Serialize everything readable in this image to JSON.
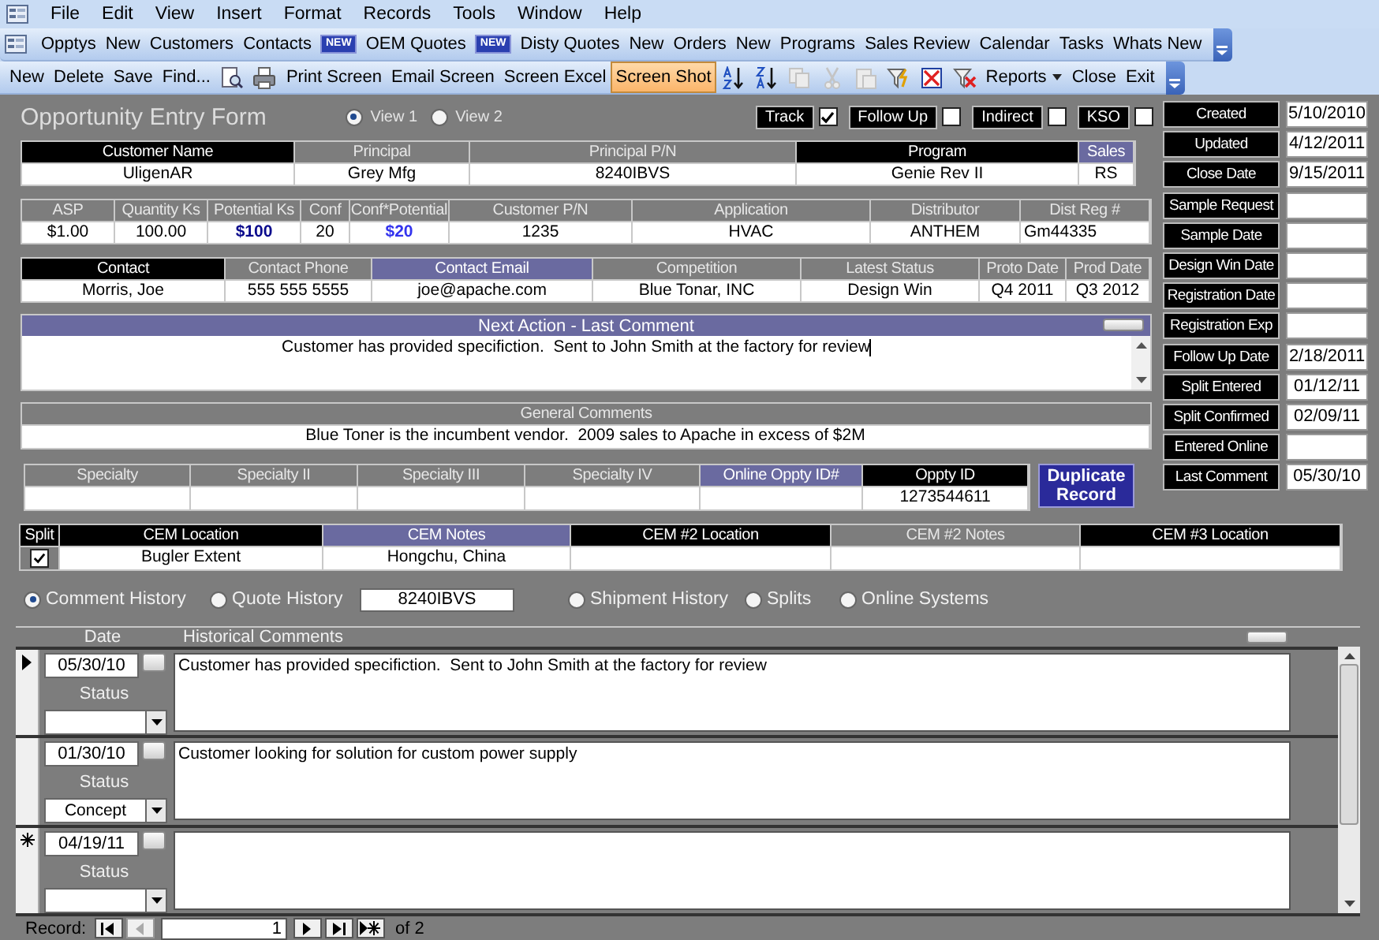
{
  "menu_bar": {
    "items": [
      "File",
      "Edit",
      "View",
      "Insert",
      "Format",
      "Records",
      "Tools",
      "Window",
      "Help"
    ]
  },
  "main_toolbar": {
    "items": [
      {
        "kind": "button",
        "label": "Opptys"
      },
      {
        "kind": "button",
        "label": "New"
      },
      {
        "kind": "button",
        "label": "Customers"
      },
      {
        "kind": "button",
        "label": "Contacts"
      },
      {
        "kind": "badge",
        "label": "NEW"
      },
      {
        "kind": "button",
        "label": "OEM Quotes"
      },
      {
        "kind": "badge",
        "label": "NEW"
      },
      {
        "kind": "button",
        "label": "Disty Quotes"
      },
      {
        "kind": "button",
        "label": "New"
      },
      {
        "kind": "button",
        "label": "Orders"
      },
      {
        "kind": "button",
        "label": "New"
      },
      {
        "kind": "button",
        "label": "Programs"
      },
      {
        "kind": "button",
        "label": "Sales Review"
      },
      {
        "kind": "button",
        "label": "Calendar"
      },
      {
        "kind": "button",
        "label": "Tasks"
      },
      {
        "kind": "button",
        "label": "Whats New"
      }
    ]
  },
  "record_toolbar": {
    "items": [
      {
        "kind": "button",
        "label": "New",
        "selected": false
      },
      {
        "kind": "button",
        "label": "Delete",
        "selected": false
      },
      {
        "kind": "button",
        "label": "Save",
        "selected": false
      },
      {
        "kind": "button",
        "label": "Find...",
        "selected": false
      },
      {
        "kind": "icon",
        "disabled": false
      },
      {
        "kind": "icon",
        "disabled": false
      },
      {
        "kind": "button",
        "label": "Print Screen",
        "selected": false
      },
      {
        "kind": "button",
        "label": "Email Screen",
        "selected": false
      },
      {
        "kind": "button",
        "label": "Screen Excel",
        "selected": false
      },
      {
        "kind": "button",
        "label": "Screen Shot",
        "selected": true
      },
      {
        "kind": "icon",
        "disabled": false
      },
      {
        "kind": "icon",
        "disabled": false
      },
      {
        "kind": "icon",
        "disabled": true
      },
      {
        "kind": "icon",
        "disabled": true
      },
      {
        "kind": "icon",
        "disabled": true
      },
      {
        "kind": "icon",
        "disabled": false
      },
      {
        "kind": "icon",
        "disabled": false
      },
      {
        "kind": "icon",
        "disabled": false
      },
      {
        "kind": "menu",
        "label": "Reports"
      },
      {
        "kind": "button",
        "label": "Close",
        "selected": false
      },
      {
        "kind": "button",
        "label": "Exit",
        "selected": false
      }
    ]
  },
  "form": {
    "title": "Opportunity Entry Form",
    "views": [
      {
        "label": "View 1",
        "selected": true
      },
      {
        "label": "View 2",
        "selected": false
      }
    ],
    "flags": [
      {
        "label": "Track",
        "checked": true
      },
      {
        "label": "Follow Up",
        "checked": false
      },
      {
        "label": "Indirect",
        "checked": false
      },
      {
        "label": "KSO",
        "checked": false
      }
    ],
    "field_groups": [
      {
        "fields": [
          {
            "label": "Customer Name",
            "kind": "dark",
            "value": "UligenAR"
          },
          {
            "label": "Principal",
            "kind": "plain",
            "value": "Grey Mfg"
          },
          {
            "label": "Principal P/N",
            "kind": "plain",
            "value": "8240IBVS"
          },
          {
            "label": "Program",
            "kind": "dark",
            "value": "Genie Rev II"
          },
          {
            "label": "Sales",
            "kind": "accent",
            "value": "RS"
          }
        ]
      },
      {
        "fields": [
          {
            "label": "ASP",
            "kind": "plain",
            "value": "$1.00"
          },
          {
            "label": "Quantity Ks",
            "kind": "plain",
            "value": "100.00"
          },
          {
            "label": "Potential Ks",
            "kind": "plain",
            "value": "$100",
            "color": "#0a0a8c"
          },
          {
            "label": "Conf",
            "kind": "plain",
            "value": "20"
          },
          {
            "label": "Conf*Potential",
            "kind": "plain",
            "value": "$20",
            "color": "#3333ee"
          },
          {
            "label": "Customer P/N",
            "kind": "plain",
            "value": "1235"
          },
          {
            "label": "Application",
            "kind": "plain",
            "value": "HVAC"
          },
          {
            "label": "Distributor",
            "kind": "plain",
            "value": "ANTHEM"
          },
          {
            "label": "Dist Reg #",
            "kind": "plain",
            "value": "Gm44335"
          }
        ]
      },
      {
        "fields": [
          {
            "label": "Contact",
            "kind": "dark",
            "value": "Morris, Joe"
          },
          {
            "label": "Contact Phone",
            "kind": "plain",
            "value": "555 555 5555"
          },
          {
            "label": "Contact Email",
            "kind": "accent",
            "value": "joe@apache.com"
          },
          {
            "label": "Competition",
            "kind": "plain",
            "value": "Blue Tonar, INC"
          },
          {
            "label": "Latest Status",
            "kind": "plain",
            "value": "Design Win"
          },
          {
            "label": "Proto Date",
            "kind": "plain",
            "value": "Q4 2011"
          },
          {
            "label": "Prod Date",
            "kind": "plain",
            "value": "Q3 2012"
          }
        ]
      }
    ],
    "next_action": {
      "label": "Next Action - Last Comment",
      "value": "Customer has provided specifiction.  Sent to John Smith at the factory for review"
    },
    "general_comments": {
      "label": "General Comments",
      "value": "Blue Toner is the incumbent vendor.  2009 sales to Apache in excess of $2M"
    },
    "specialty_fields": [
      {
        "label": "Specialty",
        "kind": "plain"
      },
      {
        "label": "Specialty II",
        "kind": "plain"
      },
      {
        "label": "Specialty III",
        "kind": "plain"
      },
      {
        "label": "Specialty IV",
        "kind": "plain"
      },
      {
        "label": "Online Oppty ID#",
        "kind": "accent"
      },
      {
        "label": "Oppty ID",
        "kind": "dark",
        "value": "1273544611"
      }
    ],
    "duplicate_button": "Duplicate Record",
    "dates": [
      {
        "label": "Created",
        "value": "5/10/2010"
      },
      {
        "label": "Updated",
        "value": "4/12/2011"
      },
      {
        "label": "Close Date",
        "value": "9/15/2011"
      },
      {
        "label": "Sample Request"
      },
      {
        "label": "Sample Date"
      },
      {
        "label": "Design Win Date"
      },
      {
        "label": "Registration Date"
      },
      {
        "label": "Registration Exp"
      },
      {
        "label": "Follow Up Date",
        "value": "2/18/2011"
      },
      {
        "label": "Split Entered",
        "value": "01/12/11"
      },
      {
        "label": "Split Confirmed",
        "value": "02/09/11"
      },
      {
        "label": "Entered Online"
      },
      {
        "label": "Last Comment",
        "value": "05/30/10"
      }
    ],
    "cem": {
      "split": {
        "label": "Split",
        "checked": true
      },
      "fields": [
        {
          "label": "CEM Location",
          "kind": "dark",
          "value": "Bugler Extent"
        },
        {
          "label": "CEM Notes",
          "kind": "accent",
          "value": "Hongchu, China"
        },
        {
          "label": "CEM #2 Location",
          "kind": "dark"
        },
        {
          "label": "CEM #2 Notes",
          "kind": "plain"
        },
        {
          "label": "CEM #3 Location",
          "kind": "dark"
        }
      ]
    },
    "history_options": [
      {
        "kind": "radio",
        "label": "Comment History",
        "selected": true
      },
      {
        "kind": "radio",
        "label": "Quote History",
        "selected": false
      },
      {
        "kind": "field",
        "value": "8240IBVS"
      },
      {
        "kind": "radio",
        "label": "Shipment History",
        "selected": false
      },
      {
        "kind": "radio",
        "label": "Splits",
        "selected": false
      },
      {
        "kind": "radio",
        "label": "Online Systems",
        "selected": false
      }
    ],
    "history": {
      "columns": [
        "Date",
        "Historical Comments"
      ],
      "rows": [
        {
          "current": true,
          "new_record": false,
          "date": "05/30/10",
          "status_label": "Status",
          "comment": "Customer has provided specifiction.  Sent to John Smith at the factory for review"
        },
        {
          "current": false,
          "new_record": false,
          "date": "01/30/10",
          "status_label": "Status",
          "status": "Concept",
          "comment": "Customer looking for solution for custom power supply"
        },
        {
          "current": false,
          "new_record": true,
          "date": "04/19/11",
          "status_label": "Status"
        }
      ],
      "navigation": {
        "label": "Record:",
        "current": "1",
        "total": "of 2"
      }
    }
  }
}
